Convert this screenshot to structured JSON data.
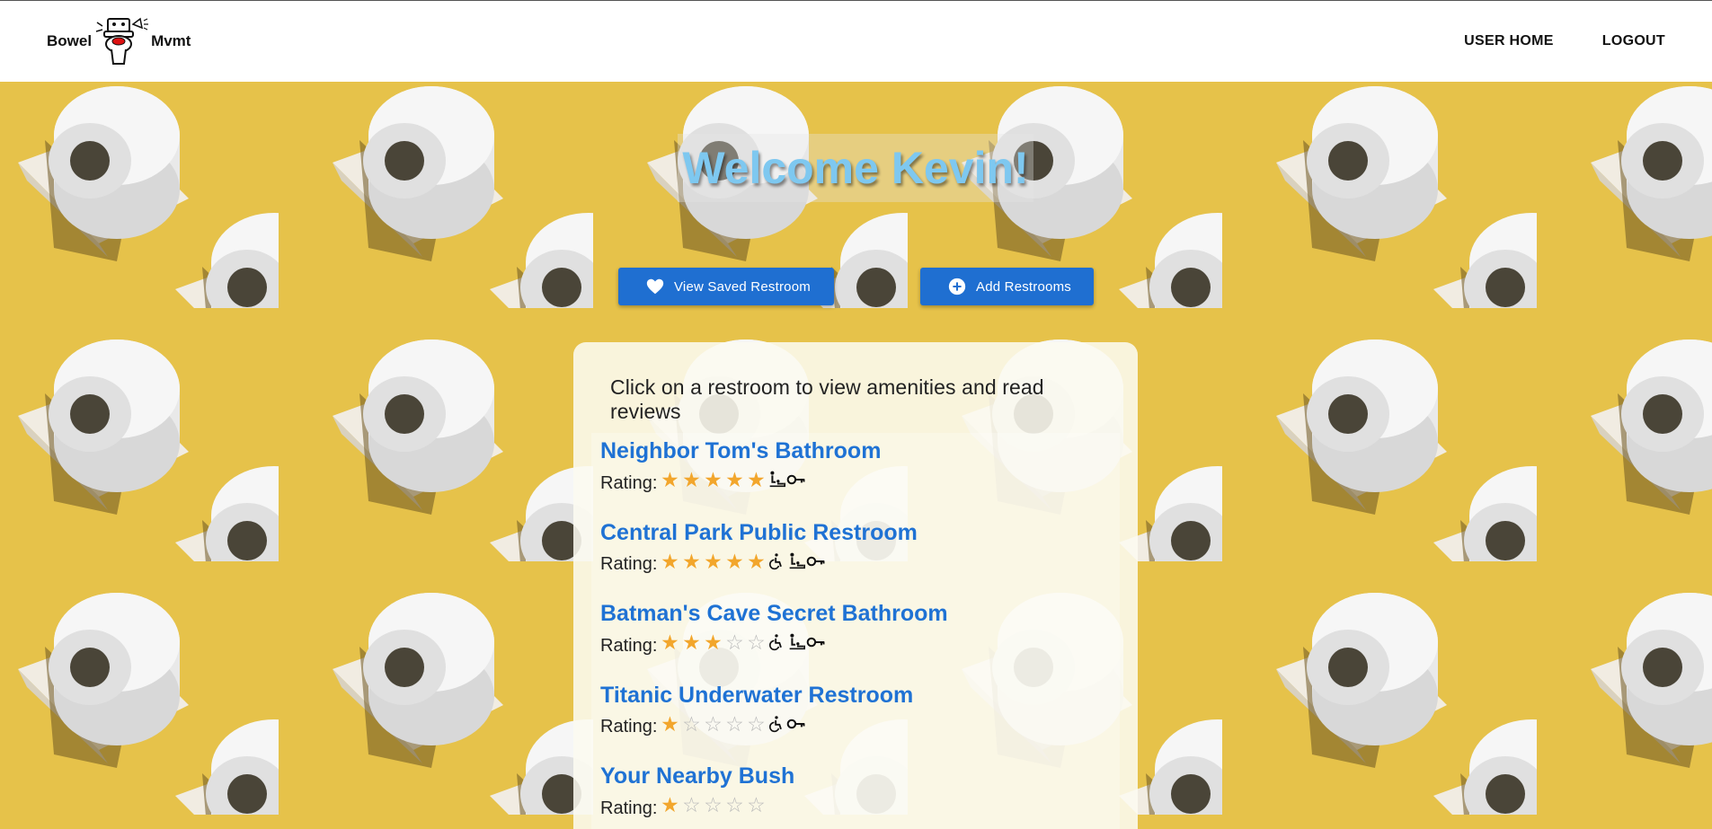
{
  "nav": {
    "logo_left": "Bowel",
    "logo_right": "Mvmt",
    "links": [
      {
        "label": "USER HOME"
      },
      {
        "label": "LOGOUT"
      }
    ]
  },
  "hero": {
    "welcome": "Welcome Kevin!"
  },
  "buttons": {
    "saved": {
      "label": "View Saved Restroom",
      "icon": "heart-icon"
    },
    "add": {
      "label": "Add Restrooms",
      "icon": "plus-circle-icon"
    }
  },
  "colors": {
    "accent": "#1f6fd1",
    "link": "#1f72d4",
    "star": "#f2a62c",
    "welcome_text": "#7ec8f0",
    "background": "#e6c24a"
  },
  "card": {
    "instructions": "Click on a restroom to view amenities and read reviews",
    "rating_label": "Rating:",
    "restrooms": [
      {
        "name": "Neighbor Tom's Bathroom",
        "rating": 5,
        "max_rating": 5,
        "amenities": [
          "baby-changing-icon",
          "key-icon"
        ]
      },
      {
        "name": "Central Park Public Restroom",
        "rating": 5,
        "max_rating": 5,
        "amenities": [
          "wheelchair-icon",
          "baby-changing-icon",
          "key-icon"
        ]
      },
      {
        "name": "Batman's Cave Secret Bathroom",
        "rating": 3,
        "max_rating": 5,
        "amenities": [
          "wheelchair-icon",
          "baby-changing-icon",
          "key-icon"
        ]
      },
      {
        "name": "Titanic Underwater Restroom",
        "rating": 1,
        "max_rating": 5,
        "amenities": [
          "wheelchair-icon",
          "key-icon"
        ]
      },
      {
        "name": "Your Nearby Bush",
        "rating": 1,
        "max_rating": 5,
        "amenities": []
      }
    ]
  }
}
